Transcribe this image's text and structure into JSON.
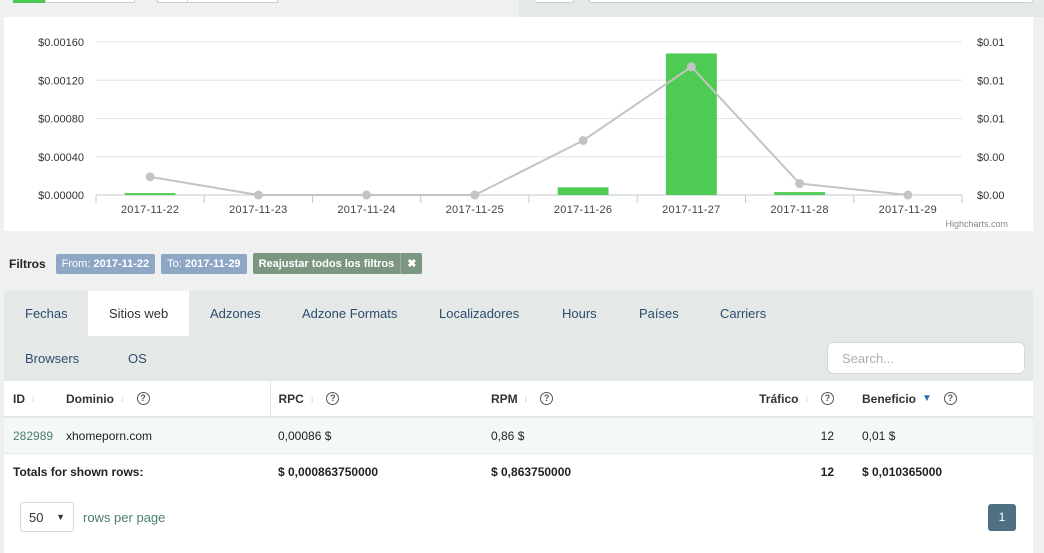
{
  "chart_data": {
    "type": "bar+line",
    "categories": [
      "2017-11-22",
      "2017-11-23",
      "2017-11-24",
      "2017-11-25",
      "2017-11-26",
      "2017-11-27",
      "2017-11-28",
      "2017-11-29"
    ],
    "y_left_ticks": [
      "$0.00000",
      "$0.00040",
      "$0.00080",
      "$0.00120",
      "$0.00160"
    ],
    "y_right_ticks": [
      "$0.00",
      "$0.00",
      "$0.01",
      "$0.01",
      "$0.01"
    ],
    "ylim_left": [
      0,
      0.0016
    ],
    "series": [
      {
        "type": "bar",
        "color": "#4dcb52",
        "values": [
          2e-05,
          0,
          0,
          0,
          8e-05,
          0.00148,
          3e-05,
          0
        ]
      },
      {
        "type": "line",
        "color": "#c4c4c4",
        "values": [
          0.0019,
          0,
          0,
          0,
          0.0057,
          0.0134,
          0.0012,
          0
        ],
        "ylim": [
          0,
          0.016
        ]
      }
    ],
    "credit": "Highcharts.com",
    "grid": true
  },
  "filters": {
    "label": "Filtros",
    "from_label": "From:",
    "from_value": "2017-11-22",
    "to_label": "To:",
    "to_value": "2017-11-29",
    "reset_label": "Reajustar todos los filtros",
    "reset_close": "✖"
  },
  "tabs": [
    {
      "label": "Fechas"
    },
    {
      "label": "Sitios web"
    },
    {
      "label": "Adzones"
    },
    {
      "label": "Adzone Formats"
    },
    {
      "label": "Localizadores"
    },
    {
      "label": "Hours"
    },
    {
      "label": "Países"
    },
    {
      "label": "Carriers"
    },
    {
      "label": "Browsers"
    },
    {
      "label": "OS"
    }
  ],
  "search": {
    "placeholder": "Search..."
  },
  "table": {
    "headers": {
      "id": "ID",
      "domain": "Dominio",
      "rpc": "RPC",
      "rpm": "RPM",
      "traffic": "Tráfico",
      "profit": "Beneficio"
    },
    "row": {
      "id": "282989",
      "domain": "xhomeporn.com",
      "rpc": "0,00086 $",
      "rpm": "0,86 $",
      "traffic": "12",
      "profit": "0,01 $"
    },
    "totals": {
      "label": "Totals for shown rows:",
      "rpc": "$ 0,000863750000",
      "rpm": "$ 0,863750000",
      "traffic": "12",
      "profit": "$ 0,010365000"
    }
  },
  "pager": {
    "rows": "50",
    "rows_label": "rows per page",
    "page": "1"
  },
  "icons": {
    "sort": "↕",
    "sort_desc": "▼",
    "help": "?",
    "caret": "▼"
  }
}
